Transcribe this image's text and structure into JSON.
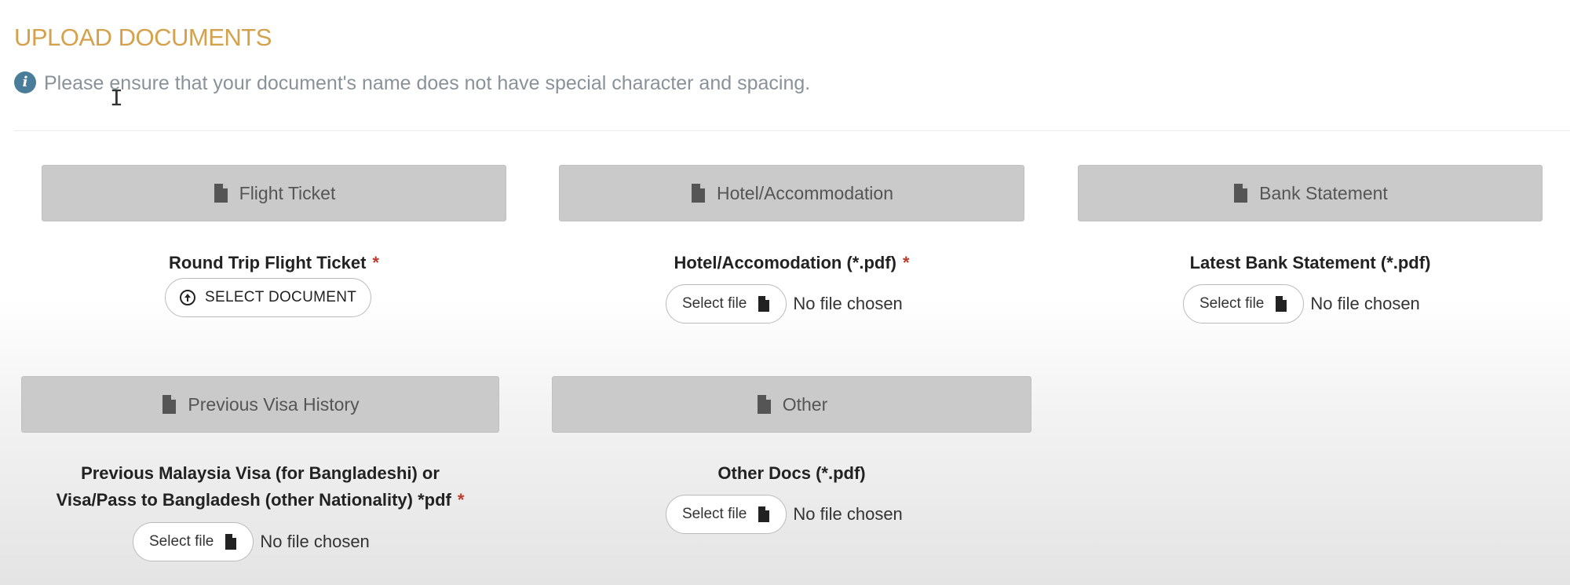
{
  "section": {
    "title": "UPLOAD DOCUMENTS",
    "notice": "Please ensure that your document's name does not have special character and spacing."
  },
  "categories": [
    {
      "header": "Flight Ticket",
      "label": "Round Trip Flight Ticket",
      "required": "*",
      "button": "SELECT DOCUMENT"
    },
    {
      "header": "Hotel/Accommodation",
      "label": "Hotel/Accomodation (*.pdf)",
      "required": "*",
      "button": "Select file",
      "status": "No file chosen"
    },
    {
      "header": "Bank Statement",
      "label": "Latest Bank Statement (*.pdf)",
      "button": "Select file",
      "status": "No file chosen"
    },
    {
      "header": "Previous Visa History",
      "label_line1": "Previous Malaysia Visa (for Bangladeshi) or",
      "label_line2": "Visa/Pass to Bangladesh (other Nationality) *pdf",
      "required": "*",
      "button": "Select file",
      "status": "No file chosen"
    },
    {
      "header": "Other",
      "label": "Other Docs (*.pdf)",
      "button": "Select file",
      "status": "No file chosen"
    }
  ],
  "icons": {
    "info": "info-circle-icon",
    "document": "file-icon",
    "upload": "upload-circle-icon"
  },
  "colors": {
    "title": "#d4a24c",
    "notice_text": "#8a9299",
    "info_icon": "#4a7d9a",
    "header_bg": "#cacaca",
    "required": "#c0392b"
  }
}
